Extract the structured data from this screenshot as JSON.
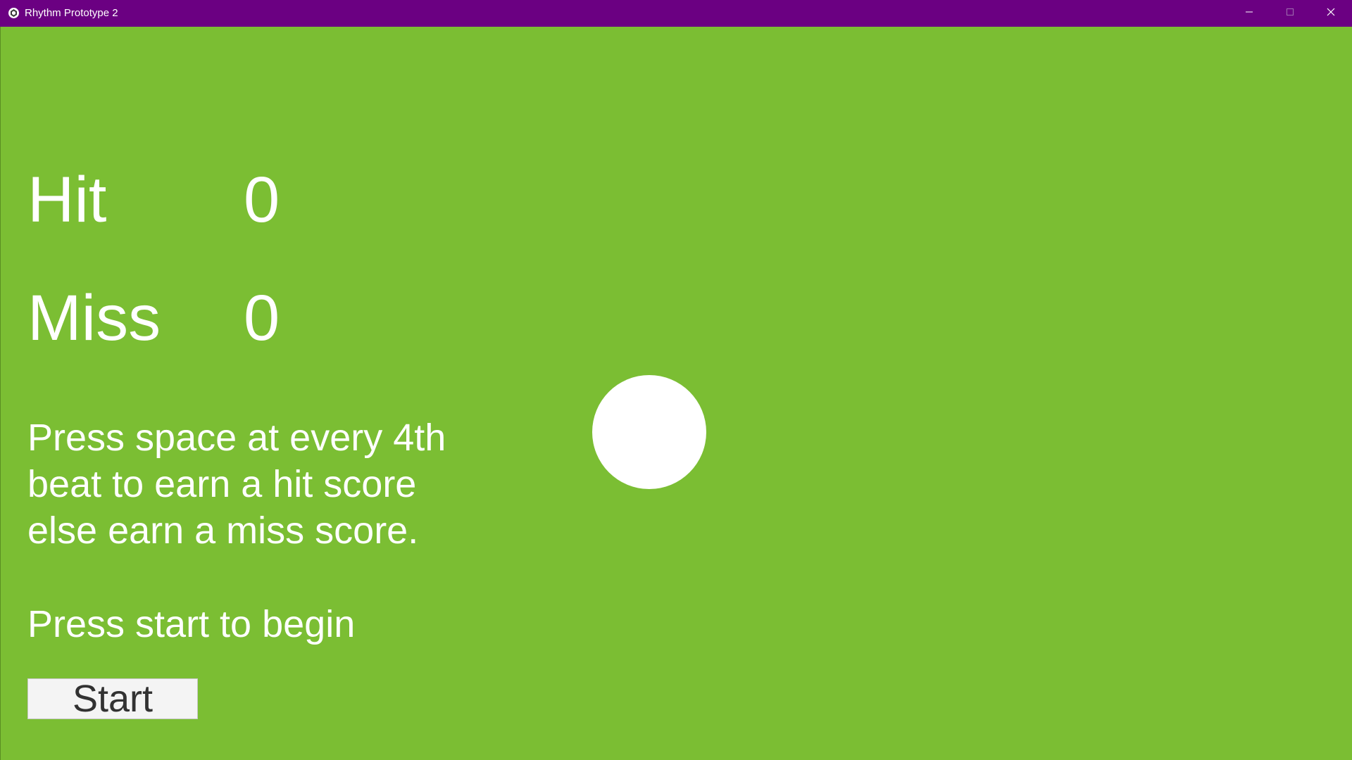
{
  "window": {
    "title": "Rhythm Prototype 2",
    "app_icon": "unity-icon",
    "background_color": "#7bbe33",
    "titlebar_color": "#6b0082"
  },
  "titlebar_buttons": {
    "minimize_icon": "minimize-icon",
    "maximize_icon": "maximize-icon",
    "close_icon": "close-icon"
  },
  "score": {
    "hit_label": "Hit",
    "hit_value": "0",
    "miss_label": "Miss",
    "miss_value": "0"
  },
  "instructions": {
    "text": "Press space at every 4th beat to earn a hit score else earn a miss score.",
    "begin_text": "Press start to begin"
  },
  "start_button": {
    "label": "Start"
  }
}
